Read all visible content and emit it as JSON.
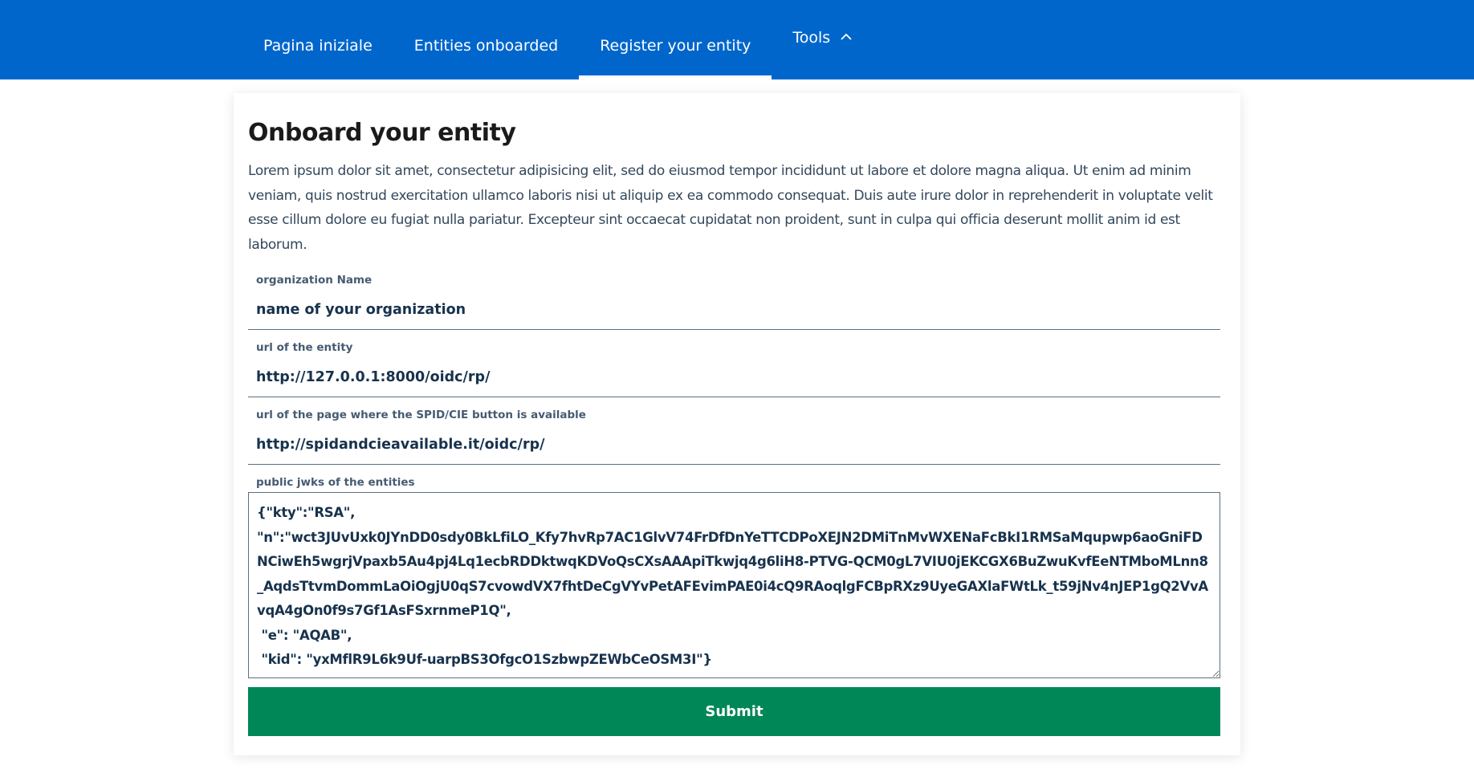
{
  "nav": {
    "items": [
      {
        "label": "Pagina iniziale",
        "active": false
      },
      {
        "label": "Entities onboarded",
        "active": false
      },
      {
        "label": "Register your entity",
        "active": true
      },
      {
        "label": "Tools",
        "active": false,
        "icon": "chevron-up-icon"
      }
    ]
  },
  "page": {
    "title": "Onboard your entity",
    "lead": "Lorem ipsum dolor sit amet, consectetur adipisicing elit, sed do eiusmod tempor incididunt ut labore et dolore magna aliqua. Ut enim ad minim veniam, quis nostrud exercitation ullamco laboris nisi ut aliquip ex ea commodo consequat. Duis aute irure dolor in reprehenderit in voluptate velit esse cillum dolore eu fugiat nulla pariatur. Excepteur sint occaecat cupidatat non proident, sunt in culpa qui officia deserunt mollit anim id est laborum."
  },
  "form": {
    "organization_name": {
      "label": "organization Name",
      "value": "name of your organization"
    },
    "entity_url": {
      "label": "url of the entity",
      "value": "http://127.0.0.1:8000/oidc/rp/"
    },
    "button_page_url": {
      "label": "url of the page where the SPID/CIE button is available",
      "value": "http://spidandcieavailable.it/oidc/rp/"
    },
    "public_jwks": {
      "label": "public jwks of the entities",
      "value": "{\"kty\":\"RSA\",\n\"n\":\"wct3JUvUxk0JYnDD0sdy0BkLfiLO_Kfy7hvRp7AC1GlvV74FrDfDnYeTTCDPoXEJN2DMiTnMvWXENaFcBkI1RMSaMqupwp6aoGniFDNCiwEh5wgrjVpaxb5Au4pj4Lq1ecbRDDktwqKDVoQsCXsAAApiTkwjq4g6liH8-PTVG-QCM0gL7VIU0jEKCGX6BuZwuKvfEeNTMboMLnn8_AqdsTtvmDommLaOiOgjU0qS7cvowdVX7fhtDeCgVYvPetAFEvimPAE0i4cQ9RAoqlgFCBpRXz9UyeGAXlaFWtLk_t59jNv4nJEP1gQ2VvAvqA4gOn0f9s7Gf1AsFSxrnmeP1Q\",\n \"e\": \"AQAB\",\n \"kid\": \"yxMflR9L6k9Uf-uarpBS3OfgcO1SzbwpZEWbCeOSM3I\"}"
    },
    "submit_label": "Submit"
  },
  "colors": {
    "header_bg": "#0066cc",
    "submit_bg": "#008758",
    "text": "#17324d"
  }
}
